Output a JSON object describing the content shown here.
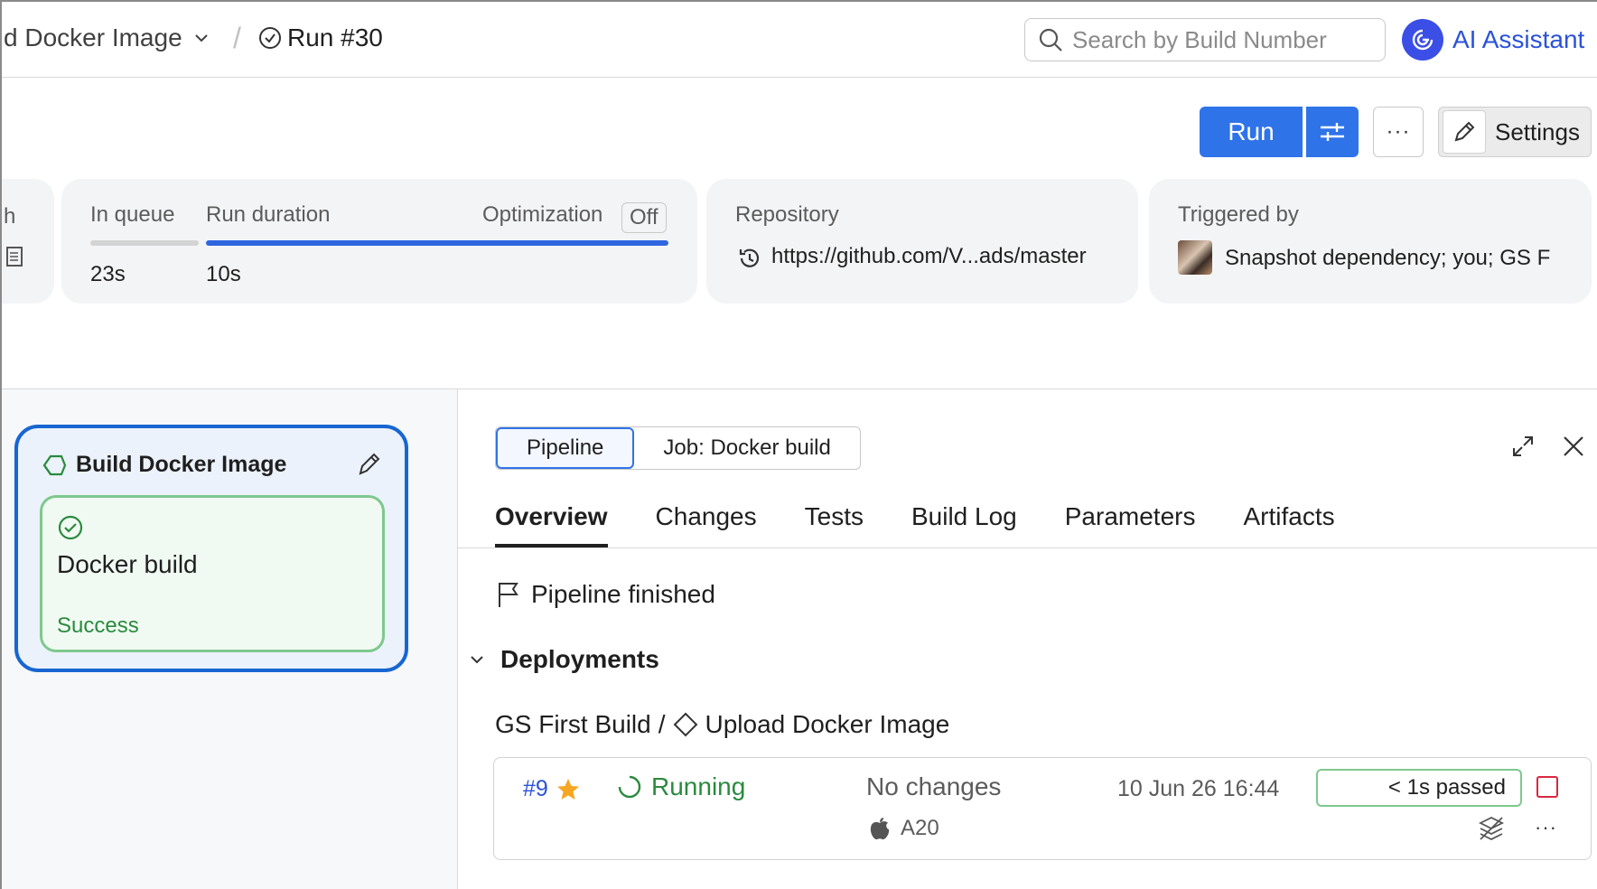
{
  "header": {
    "breadcrumb_build_config": "d Docker Image",
    "breadcrumb_separator": "/",
    "breadcrumb_run": "Run #30",
    "search_placeholder": "Search by Build Number",
    "ai_assistant": "AI Assistant"
  },
  "toolbar": {
    "run_label": "Run",
    "more_label": "···",
    "settings_label": "Settings"
  },
  "stats": {
    "partial_label": "h",
    "in_queue_label": "In queue",
    "in_queue_value": "23s",
    "in_queue_progress": 1.0,
    "run_duration_label": "Run duration",
    "run_duration_value": "10s",
    "run_duration_progress": 1.0,
    "optimization_label": "Optimization",
    "optimization_value": "Off",
    "repository_label": "Repository",
    "repository_value": "https://github.com/V...ads/master",
    "triggered_by_label": "Triggered by",
    "triggered_by_value": "Snapshot dependency; you; GS F"
  },
  "pipeline_node": {
    "title": "Build Docker Image",
    "job_name": "Docker build",
    "job_status": "Success"
  },
  "details": {
    "segments": [
      "Pipeline",
      "Job: Docker build"
    ],
    "active_segment": "Pipeline",
    "tabs": [
      "Overview",
      "Changes",
      "Tests",
      "Build Log",
      "Parameters",
      "Artifacts"
    ],
    "active_tab": "Overview",
    "pipeline_status": "Pipeline finished",
    "deployments_label": "Deployments",
    "deployment_project": "GS First Build",
    "deployment_separator": "/",
    "deployment_config": "Upload Docker Image",
    "build": {
      "number": "#9",
      "status": "Running",
      "changes": "No changes",
      "agent": "A20",
      "date": "10 Jun 26 16:44",
      "elapsed": "< 1s passed",
      "more_label": "···"
    }
  },
  "colors": {
    "accent": "#2f73e9",
    "link": "#2a52d9",
    "success": "#2a8a3e",
    "node_border": "#1766d1",
    "stop": "#d9283e"
  }
}
